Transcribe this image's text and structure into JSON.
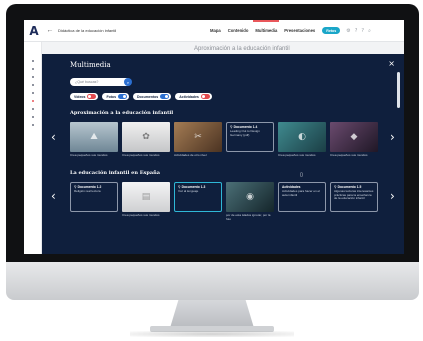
{
  "app": {
    "logo": "A",
    "back_icon": "back-arrow-icon",
    "course_title": "Didáctica de la educación infantil",
    "nav": [
      {
        "label": "Mapa"
      },
      {
        "label": "Contenido"
      },
      {
        "label": "Multimedia"
      },
      {
        "label": "Presentaciones"
      }
    ],
    "retos_label": "Retos",
    "accent_color": "#e9575b",
    "brand_color": "#1aa6c8"
  },
  "backdrop": {
    "heading": "Aproximación a la educación infantil"
  },
  "modal": {
    "title": "Multimedia",
    "close_glyph": "×",
    "search": {
      "placeholder": "¿Qué buscas?",
      "value": ""
    },
    "filters": [
      {
        "label": "Vídeos",
        "on": false
      },
      {
        "label": "Fotos",
        "on": true
      },
      {
        "label": "Documentos",
        "on": true
      },
      {
        "label": "Actividades",
        "on": false
      }
    ],
    "arrow_left": "‹",
    "arrow_right": "›",
    "sections": [
      {
        "title": "Aproximación a la educación infantil",
        "items": [
          {
            "kind": "image",
            "caption": "Crea pequeños sus mundos",
            "color": "#8fa3b0"
          },
          {
            "kind": "image",
            "caption": "Crea pequeños sus mundos",
            "color": "#d9dadb"
          },
          {
            "kind": "image",
            "caption": "Actividades de otro nivel",
            "color": "#7a5a3e"
          },
          {
            "kind": "doc",
            "type": "Documento 1.4",
            "text": "Leading Out to Design Germany (pdf)"
          },
          {
            "kind": "image",
            "caption": "Crea pequeños sus mundos",
            "color": "#2f6f78"
          },
          {
            "kind": "image",
            "caption": "Crea pequeños sus mundos",
            "color": "#3b2c4a"
          },
          {
            "kind": "image",
            "caption": "por de esta islados ignorar, por la foto",
            "color": "#3a9ec2"
          }
        ]
      },
      {
        "title": "La educación infantil en España",
        "items": [
          {
            "kind": "doc",
            "type": "Documento 1.2",
            "text": "Religión real lectura"
          },
          {
            "kind": "image",
            "caption": "Crea pequeños sus mundos",
            "color": "#e3e4e6"
          },
          {
            "kind": "doc",
            "type": "Documento 1.3",
            "text": "Voz al lenguaje",
            "highlight": true
          },
          {
            "kind": "image",
            "caption": "por de esta islados ignorar, por la foto",
            "color": "#2d4a52"
          },
          {
            "kind": "doc",
            "type": "Actividades",
            "text": "Actividades para hacer en el aula infantil"
          },
          {
            "kind": "doc",
            "type": "Documento 1.5",
            "text": "Algunas lecturas interesantes prácticas para la enseñanza de la educación infantil"
          }
        ]
      }
    ]
  }
}
